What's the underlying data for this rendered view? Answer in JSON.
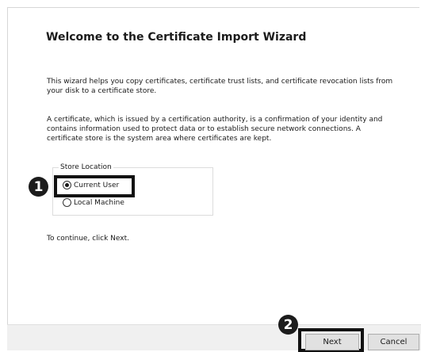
{
  "wizard": {
    "title": "Welcome to the Certificate Import Wizard",
    "intro": "This wizard helps you copy certificates, certificate trust lists, and certificate revocation lists from your disk to a certificate store.",
    "description": "A certificate, which is issued by a certification authority, is a confirmation of your identity and contains information used to protect data or to establish secure network connections. A certificate store is the system area where certificates are kept.",
    "store_location": {
      "legend": "Store Location",
      "options": [
        {
          "label": "Current User",
          "selected": true
        },
        {
          "label": "Local Machine",
          "selected": false
        }
      ]
    },
    "continue_text": "To continue, click Next."
  },
  "buttons": {
    "next": "Next",
    "cancel": "Cancel"
  },
  "callouts": {
    "one": "1",
    "two": "2"
  }
}
